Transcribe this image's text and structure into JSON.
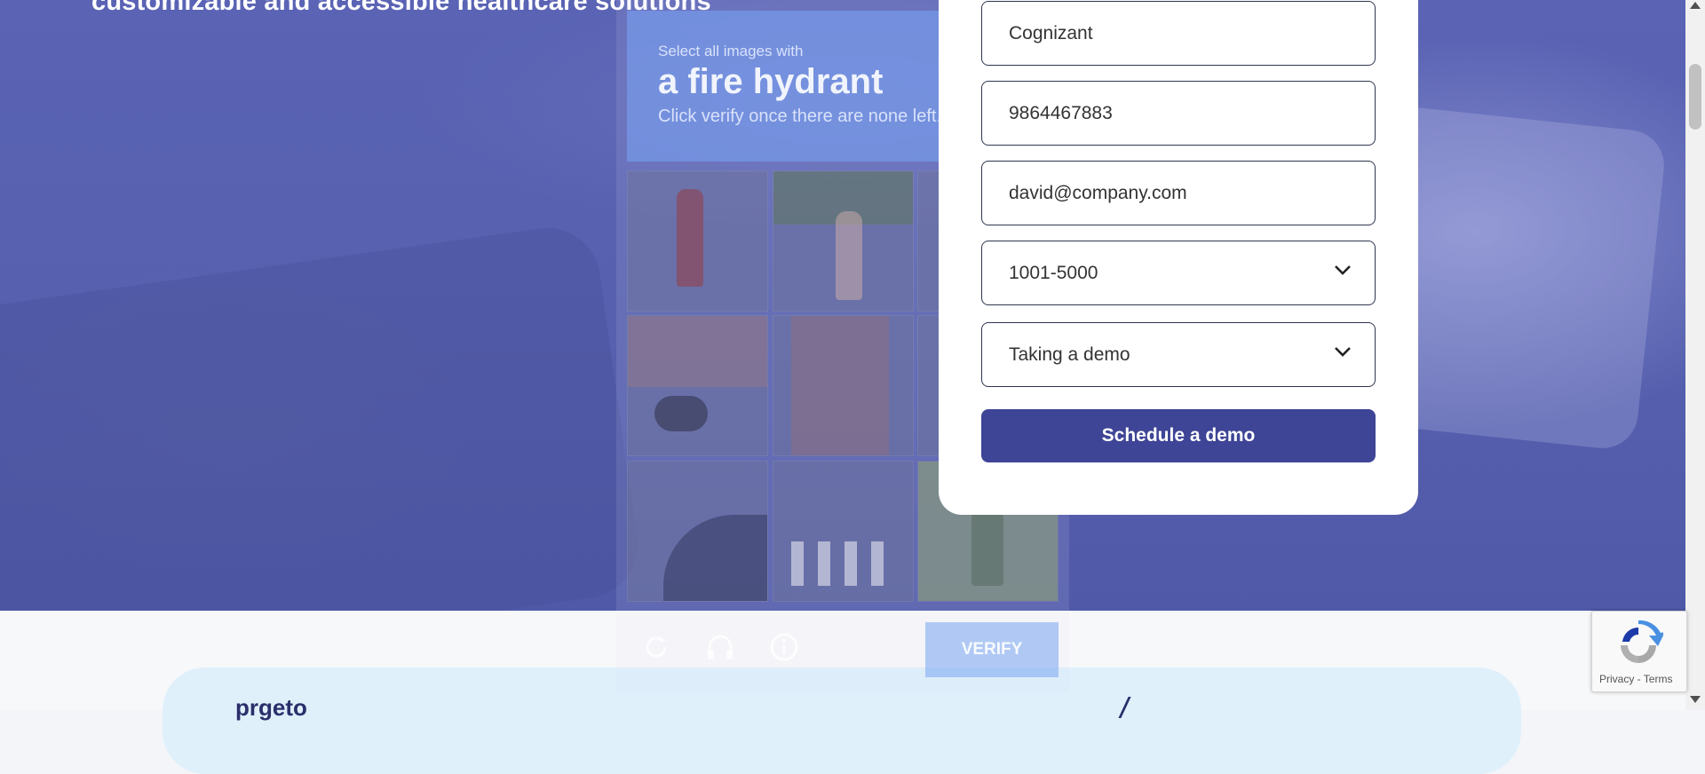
{
  "hero": {
    "title": "customizable and accessible healthcare solutions"
  },
  "captcha": {
    "prompt": "Select all images with",
    "target": "a fire hydrant",
    "instruction": "Click verify once there are none left.",
    "tiles": [
      "hydrant-1",
      "hydrant-2",
      "street-car",
      "motorbikes",
      "shop-front",
      "car-side",
      "road-curve",
      "crosswalk",
      "hydrant-3"
    ],
    "icons": [
      "refresh-icon",
      "headphones-icon",
      "info-icon"
    ],
    "verify_label": "VERIFY"
  },
  "form": {
    "company": "Cognizant",
    "phone": "9864467883",
    "email": "david@company.com",
    "company_size": "1001-5000",
    "interest": "Taking a demo",
    "submit_label": "Schedule a demo"
  },
  "recaptcha": {
    "links": "Privacy - Terms"
  },
  "lower": {
    "brand_partial": "prgeto"
  },
  "colors": {
    "hero": "#5660ae",
    "button": "#3e4596",
    "captcha_header": "#78a0f0"
  }
}
